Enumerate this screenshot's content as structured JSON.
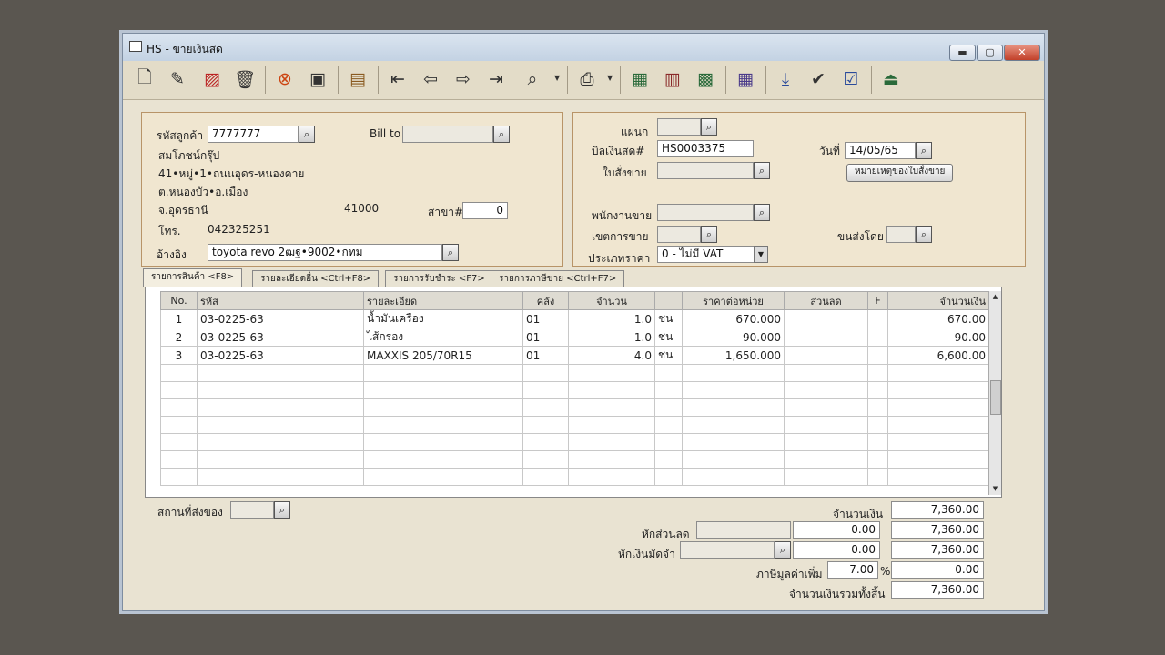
{
  "window": {
    "title": "HS - ขายเงินสด",
    "min": "▬",
    "max": "▢",
    "close": "✕"
  },
  "toolbar": {
    "icons": [
      "new-doc-icon",
      "edit-icon",
      "cancel-doc-icon",
      "delete-icon",
      "stop-icon",
      "save-icon",
      "open-book-icon",
      "first-record-icon",
      "prev-record-icon",
      "next-record-icon",
      "last-record-icon",
      "find-icon",
      "print-icon",
      "export-icon",
      "report-icon",
      "calc-icon",
      "calendar-icon",
      "import-icon",
      "approve-icon",
      "ok-icon",
      "exit-icon"
    ],
    "dropdown": "▼"
  },
  "customer": {
    "code_label": "รหัสลูกค้า",
    "code": "7777777",
    "bill_to_label": "Bill to",
    "bill_to": "",
    "name": "สมโภชน์กรุ๊ป",
    "address1": "41•หมู่•1•ถนนอุดร-หนองคาย",
    "address2": "ต.หนองบัว•อ.เมือง",
    "province": "จ.อุดรธานี",
    "postcode": "41000",
    "branch_label": "สาขา#",
    "branch": "0",
    "phone_label": "โทร.",
    "phone": "042325251",
    "reference_label": "อ้างอิง",
    "reference": "toyota revo 2ฒฐ•9002•กทม"
  },
  "document": {
    "dept_label": "แผนก",
    "dept": "",
    "bill_no_label": "บิลเงินสด#",
    "bill_no": "HS0003375",
    "date_label": "วันที่",
    "date": "14/05/65",
    "so_label": "ใบสั่งขาย",
    "so": "",
    "so_note_button": "หมายเหตุของใบสั่งขาย",
    "salesman_label": "พนักงานขาย",
    "salesman": "",
    "sales_zone_label": "เขตการขาย",
    "sales_zone": "",
    "ship_by_label": "ขนส่งโดย",
    "ship_by": "",
    "price_type_label": "ประเภทราคา",
    "price_type": "0 - ไม่มี VAT"
  },
  "tabs": [
    "รายการสินค้า <F8>",
    "รายละเอียดอื่น <Ctrl+F8>",
    "รายการรับชำระ <F7>",
    "รายการภาษีขาย <Ctrl+F7>"
  ],
  "grid": {
    "headers": [
      "No.",
      "รหัส",
      "รายละเอียด",
      "คลัง",
      "จำนวน",
      "",
      "ราคาต่อหน่วย",
      "ส่วนลด",
      "F",
      "จำนวนเงิน"
    ],
    "rows": [
      {
        "no": "1",
        "code": "03-0225-63",
        "desc": "น้ำมันเครื่อง",
        "wh": "01",
        "qty": "1.0",
        "unit": "ชน",
        "price": "670.000",
        "disc": "",
        "f": "",
        "amount": "670.00"
      },
      {
        "no": "2",
        "code": "03-0225-63",
        "desc": "ไส้กรอง",
        "wh": "01",
        "qty": "1.0",
        "unit": "ชน",
        "price": "90.000",
        "disc": "",
        "f": "",
        "amount": "90.00"
      },
      {
        "no": "3",
        "code": "03-0225-63",
        "desc": "MAXXIS 205/70R15",
        "wh": "01",
        "qty": "4.0",
        "unit": "ชน",
        "price": "1,650.000",
        "disc": "",
        "f": "",
        "amount": "6,600.00"
      }
    ]
  },
  "footer": {
    "ship_place_label": "สถานที่ส่งของ",
    "ship_place": "",
    "amount_label": "จำนวนเงิน",
    "amount": "7,360.00",
    "discount_label": "หักส่วนลด",
    "discount_text": "",
    "discount": "0.00",
    "discount_total": "7,360.00",
    "deposit_label": "หักเงินมัดจำ",
    "deposit_text": "",
    "deposit": "0.00",
    "deposit_total": "7,360.00",
    "vat_label": "ภาษีมูลค่าเพิ่ม",
    "vat_rate": "7.00",
    "vat_pct": "%",
    "vat": "0.00",
    "grand_total_label": "จำนวนเงินรวมทั้งสิ้น",
    "grand_total": "7,360.00"
  }
}
